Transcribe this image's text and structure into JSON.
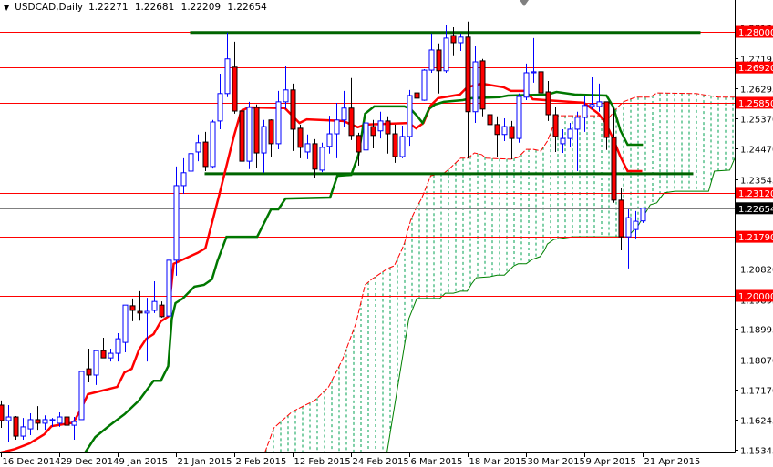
{
  "header": {
    "symbol": "USDCAD,Daily",
    "open": "1.22271",
    "high": "1.22681",
    "low": "1.22209",
    "close": "1.22654"
  },
  "colors": {
    "bull": "#0000ff",
    "bear_fill": "#ff0000",
    "bear_outline": "#000000",
    "tenkan": "#ff0000",
    "kijun": "#007700",
    "senkou_a": "#ff0000",
    "senkou_b": "#008000",
    "cloud": "#00a050",
    "level_line": "#ff0000",
    "trend_line": "#006400",
    "current_price": "#808080"
  },
  "chart_data": {
    "type": "candlestick",
    "title": "USDCAD,Daily",
    "ylim": [
      1.15255,
      1.28966
    ],
    "xlim_bars": [
      0,
      100.7
    ],
    "grid": false,
    "ohlc": [
      [
        1.1669,
        1.1683,
        1.16,
        1.1622
      ],
      [
        1.1622,
        1.1669,
        1.1558,
        1.1633
      ],
      [
        1.1633,
        1.1636,
        1.1564,
        1.1575
      ],
      [
        1.1575,
        1.163,
        1.1564,
        1.1603
      ],
      [
        1.1597,
        1.1644,
        1.1578,
        1.1625
      ],
      [
        1.1625,
        1.1666,
        1.1594,
        1.1614
      ],
      [
        1.1614,
        1.1638,
        1.1594,
        1.1625
      ],
      [
        1.1622,
        1.163,
        1.1603,
        1.1625
      ],
      [
        1.1614,
        1.1647,
        1.1603,
        1.1633
      ],
      [
        1.1633,
        1.1649,
        1.1592,
        1.1608
      ],
      [
        1.1608,
        1.1633,
        1.1564,
        1.1619
      ],
      [
        1.1625,
        1.1771,
        1.1625,
        1.1771
      ],
      [
        1.1779,
        1.184,
        1.1738,
        1.176
      ],
      [
        1.176,
        1.1837,
        1.173,
        1.1834
      ],
      [
        1.1834,
        1.1873,
        1.1812,
        1.1812
      ],
      [
        1.1812,
        1.184,
        1.1801,
        1.1826
      ],
      [
        1.1826,
        1.1887,
        1.1801,
        1.187
      ],
      [
        1.1859,
        1.1972,
        1.1829,
        1.1972
      ],
      [
        1.197,
        1.1992,
        1.1923,
        1.1956
      ],
      [
        1.1953,
        1.2014,
        1.1925,
        1.1948
      ],
      [
        1.1948,
        1.1994,
        1.1801,
        1.1953
      ],
      [
        1.1956,
        1.2044,
        1.1948,
        1.1983
      ],
      [
        1.1972,
        1.1983,
        1.1934,
        1.1937
      ],
      [
        1.1939,
        1.2108,
        1.1939,
        1.2108
      ],
      [
        1.2108,
        1.2392,
        1.2061,
        1.2334
      ],
      [
        1.2334,
        1.2417,
        1.2309,
        1.2373
      ],
      [
        1.2378,
        1.2455,
        1.2353,
        1.2431
      ],
      [
        1.2436,
        1.2489,
        1.2408,
        1.2464
      ],
      [
        1.2466,
        1.2497,
        1.2378,
        1.2392
      ],
      [
        1.2392,
        1.2533,
        1.2386,
        1.2527
      ],
      [
        1.253,
        1.2673,
        1.2505,
        1.2613
      ],
      [
        1.2613,
        1.2798,
        1.2602,
        1.2718
      ],
      [
        1.2693,
        1.277,
        1.2552,
        1.256
      ],
      [
        1.256,
        1.264,
        1.2345,
        1.2408
      ],
      [
        1.2408,
        1.2588,
        1.2384,
        1.2571
      ],
      [
        1.2571,
        1.258,
        1.2389,
        1.2433
      ],
      [
        1.2433,
        1.2533,
        1.2373,
        1.2513
      ],
      [
        1.2533,
        1.2535,
        1.2422,
        1.2461
      ],
      [
        1.2461,
        1.2621,
        1.2444,
        1.2588
      ],
      [
        1.2588,
        1.2696,
        1.2566,
        1.2624
      ],
      [
        1.2624,
        1.2643,
        1.2439,
        1.2505
      ],
      [
        1.2508,
        1.2519,
        1.2417,
        1.245
      ],
      [
        1.2436,
        1.2489,
        1.2414,
        1.2461
      ],
      [
        1.2461,
        1.2475,
        1.2356,
        1.2384
      ],
      [
        1.2381,
        1.2464,
        1.2375,
        1.245
      ],
      [
        1.2453,
        1.2546,
        1.2431,
        1.2491
      ],
      [
        1.2491,
        1.2585,
        1.2417,
        1.2533
      ],
      [
        1.2533,
        1.2621,
        1.2511,
        1.2569
      ],
      [
        1.2569,
        1.266,
        1.2472,
        1.2486
      ],
      [
        1.2486,
        1.2494,
        1.2395,
        1.2436
      ],
      [
        1.2442,
        1.2533,
        1.2386,
        1.2524
      ],
      [
        1.2513,
        1.2533,
        1.2447,
        1.2486
      ],
      [
        1.25,
        1.2558,
        1.2477,
        1.253
      ],
      [
        1.253,
        1.2544,
        1.2431,
        1.2491
      ],
      [
        1.2491,
        1.2519,
        1.2403,
        1.2422
      ],
      [
        1.2422,
        1.2516,
        1.2417,
        1.2483
      ],
      [
        1.2483,
        1.2624,
        1.2455,
        1.2607
      ],
      [
        1.2615,
        1.2624,
        1.2569,
        1.2599
      ],
      [
        1.2593,
        1.2687,
        1.2591,
        1.2684
      ],
      [
        1.2684,
        1.2795,
        1.2676,
        1.2745
      ],
      [
        1.2745,
        1.2765,
        1.2613,
        1.2682
      ],
      [
        1.2682,
        1.282,
        1.2676,
        1.2781
      ],
      [
        1.2789,
        1.2814,
        1.2729,
        1.2767
      ],
      [
        1.2767,
        1.2795,
        1.2742,
        1.2784
      ],
      [
        1.2784,
        1.2831,
        1.2417,
        1.2558
      ],
      [
        1.2558,
        1.2756,
        1.2524,
        1.2709
      ],
      [
        1.2712,
        1.2718,
        1.2544,
        1.2566
      ],
      [
        1.2549,
        1.2613,
        1.2491,
        1.2519
      ],
      [
        1.2519,
        1.2544,
        1.2422,
        1.2489
      ],
      [
        1.2489,
        1.2538,
        1.2469,
        1.2513
      ],
      [
        1.2513,
        1.253,
        1.2414,
        1.2477
      ],
      [
        1.2477,
        1.2613,
        1.2464,
        1.2604
      ],
      [
        1.2602,
        1.2704,
        1.2593,
        1.2676
      ],
      [
        1.2676,
        1.2781,
        1.2646,
        1.2679
      ],
      [
        1.2679,
        1.2707,
        1.2574,
        1.2615
      ],
      [
        1.2618,
        1.2651,
        1.253,
        1.2549
      ],
      [
        1.2549,
        1.2571,
        1.2436,
        1.2483
      ],
      [
        1.2461,
        1.2505,
        1.2433,
        1.2477
      ],
      [
        1.2477,
        1.2524,
        1.245,
        1.2505
      ],
      [
        1.2505,
        1.2558,
        1.2378,
        1.2541
      ],
      [
        1.2541,
        1.2607,
        1.2497,
        1.2577
      ],
      [
        1.2574,
        1.2662,
        1.2566,
        1.258
      ],
      [
        1.2574,
        1.2643,
        1.2558,
        1.2588
      ],
      [
        1.2588,
        1.2588,
        1.2442,
        1.248
      ],
      [
        1.248,
        1.2569,
        1.2282,
        1.229
      ],
      [
        1.229,
        1.2326,
        1.2138,
        1.2179
      ],
      [
        1.2179,
        1.2262,
        1.2083,
        1.2237
      ],
      [
        1.2201,
        1.2257,
        1.2174,
        1.2226
      ],
      [
        1.22271,
        1.22681,
        1.22209,
        1.22654
      ]
    ],
    "tenkan": [
      [
        0,
        1.1525
      ],
      [
        2,
        1.1536
      ],
      [
        4,
        1.1553
      ],
      [
        6,
        1.158
      ],
      [
        7,
        1.1605
      ],
      [
        10,
        1.1616
      ],
      [
        11,
        1.1655
      ],
      [
        12,
        1.1702
      ],
      [
        16,
        1.1724
      ],
      [
        17,
        1.1768
      ],
      [
        18,
        1.1779
      ],
      [
        19,
        1.1837
      ],
      [
        20,
        1.187
      ],
      [
        21,
        1.1884
      ],
      [
        22,
        1.1923
      ],
      [
        23,
        1.1937
      ],
      [
        23.75,
        1.2097
      ],
      [
        27,
        1.213
      ],
      [
        28.1,
        1.2144
      ],
      [
        30,
        1.2306
      ],
      [
        32,
        1.2483
      ],
      [
        33,
        1.256
      ],
      [
        34,
        1.2571
      ],
      [
        39,
        1.2569
      ],
      [
        41,
        1.2524
      ],
      [
        42,
        1.2535
      ],
      [
        47,
        1.253
      ],
      [
        49,
        1.2511
      ],
      [
        50,
        1.2519
      ],
      [
        56,
        1.2524
      ],
      [
        57,
        1.2508
      ],
      [
        58,
        1.2524
      ],
      [
        59,
        1.2577
      ],
      [
        60,
        1.2599
      ],
      [
        63,
        1.261
      ],
      [
        64,
        1.2632
      ],
      [
        66,
        1.2643
      ],
      [
        69,
        1.2632
      ],
      [
        70,
        1.2621
      ],
      [
        72,
        1.2621
      ],
      [
        73,
        1.2596
      ],
      [
        80,
        1.2585
      ],
      [
        82,
        1.2552
      ],
      [
        83,
        1.2524
      ],
      [
        84,
        1.2477
      ],
      [
        85,
        1.2422
      ],
      [
        86,
        1.2378
      ],
      [
        88,
        1.2378
      ]
    ],
    "kijun": [
      [
        11.6,
        1.1525
      ],
      [
        13,
        1.1572
      ],
      [
        15,
        1.1608
      ],
      [
        17,
        1.1641
      ],
      [
        19,
        1.1683
      ],
      [
        21,
        1.1743
      ],
      [
        22,
        1.1743
      ],
      [
        23,
        1.1787
      ],
      [
        23.5,
        1.1931
      ],
      [
        24,
        1.1978
      ],
      [
        25,
        1.1992
      ],
      [
        26.6,
        1.2028
      ],
      [
        27.9,
        1.2033
      ],
      [
        29,
        1.205
      ],
      [
        29.75,
        1.2105
      ],
      [
        31,
        1.2179
      ],
      [
        35.2,
        1.2179
      ],
      [
        37.1,
        1.2262
      ],
      [
        38.1,
        1.2262
      ],
      [
        39.1,
        1.2295
      ],
      [
        45.2,
        1.2298
      ],
      [
        46.2,
        1.2364
      ],
      [
        48.1,
        1.2367
      ],
      [
        49.1,
        1.2428
      ],
      [
        50,
        1.2552
      ],
      [
        51.25,
        1.2574
      ],
      [
        55.4,
        1.2574
      ],
      [
        56.25,
        1.2566
      ],
      [
        57.1,
        1.2546
      ],
      [
        57.9,
        1.2524
      ],
      [
        58.75,
        1.2566
      ],
      [
        59.6,
        1.258
      ],
      [
        60.8,
        1.2588
      ],
      [
        63.4,
        1.2593
      ],
      [
        64.6,
        1.2599
      ],
      [
        68.4,
        1.2602
      ],
      [
        69.6,
        1.2607
      ],
      [
        75,
        1.261
      ],
      [
        76.25,
        1.2618
      ],
      [
        78.75,
        1.261
      ],
      [
        83.1,
        1.2607
      ],
      [
        84,
        1.2574
      ],
      [
        85,
        1.2502
      ],
      [
        86,
        1.2458
      ],
      [
        88.1,
        1.2458
      ]
    ],
    "senkou_a": [
      [
        36.25,
        1.1525
      ],
      [
        37.5,
        1.16
      ],
      [
        40,
        1.1649
      ],
      [
        43.1,
        1.1683
      ],
      [
        45,
        1.1724
      ],
      [
        46.9,
        1.1807
      ],
      [
        48.75,
        1.1917
      ],
      [
        50,
        1.2033
      ],
      [
        50.9,
        1.205
      ],
      [
        53.1,
        1.2083
      ],
      [
        54,
        1.2091
      ],
      [
        55,
        1.2138
      ],
      [
        55.4,
        1.216
      ],
      [
        56.25,
        1.2229
      ],
      [
        57.1,
        1.227
      ],
      [
        57.75,
        1.2295
      ],
      [
        59,
        1.2364
      ],
      [
        60.9,
        1.2373
      ],
      [
        61.6,
        1.2386
      ],
      [
        63.1,
        1.2417
      ],
      [
        64.1,
        1.2417
      ],
      [
        65,
        1.2433
      ],
      [
        66,
        1.2428
      ],
      [
        66.6,
        1.2417
      ],
      [
        70,
        1.2414
      ],
      [
        71,
        1.242
      ],
      [
        72.1,
        1.2444
      ],
      [
        73.1,
        1.2444
      ],
      [
        74.1,
        1.2439
      ],
      [
        75,
        1.2469
      ],
      [
        75.5,
        1.2497
      ],
      [
        76.25,
        1.2546
      ],
      [
        82.1,
        1.2546
      ],
      [
        83.1,
        1.253
      ],
      [
        84.6,
        1.2571
      ],
      [
        85.4,
        1.2588
      ],
      [
        87.1,
        1.2602
      ],
      [
        89.1,
        1.2602
      ],
      [
        90,
        1.2615
      ],
      [
        95.4,
        1.2613
      ],
      [
        98.5,
        1.2602
      ],
      [
        100.75,
        1.2602
      ]
    ],
    "senkou_b": [
      [
        53,
        1.1525
      ],
      [
        56,
        1.1931
      ],
      [
        57.1,
        1.1992
      ],
      [
        60.25,
        1.1992
      ],
      [
        61,
        1.2008
      ],
      [
        62.1,
        1.2008
      ],
      [
        63.1,
        1.2014
      ],
      [
        64,
        1.2014
      ],
      [
        64.6,
        1.2036
      ],
      [
        65.25,
        1.2055
      ],
      [
        67.1,
        1.2058
      ],
      [
        68.1,
        1.2063
      ],
      [
        69.1,
        1.2063
      ],
      [
        70.4,
        1.2091
      ],
      [
        71,
        1.2097
      ],
      [
        72.1,
        1.2097
      ],
      [
        72.9,
        1.211
      ],
      [
        74,
        1.2119
      ],
      [
        74.6,
        1.2138
      ],
      [
        75,
        1.2157
      ],
      [
        75.9,
        1.2171
      ],
      [
        78.4,
        1.2179
      ],
      [
        86,
        1.2179
      ],
      [
        87.5,
        1.2215
      ],
      [
        89.1,
        1.2276
      ],
      [
        90,
        1.2282
      ],
      [
        91,
        1.2312
      ],
      [
        92.5,
        1.2317
      ],
      [
        97.1,
        1.2317
      ],
      [
        97.9,
        1.2378
      ],
      [
        100,
        1.2381
      ],
      [
        101,
        1.2433
      ]
    ],
    "level_lines": [
      {
        "price": 1.28,
        "label": "1.28000"
      },
      {
        "price": 1.2692,
        "label": "1.26920"
      },
      {
        "price": 1.2585,
        "label": "1.25850"
      },
      {
        "price": 1.2312,
        "label": "1.23120"
      },
      {
        "price": 1.2179,
        "label": "1.21790"
      },
      {
        "price": 1.2,
        "label": "1.20000"
      }
    ],
    "trend_lines": [
      {
        "from_bar": 26,
        "to_bar": 96,
        "price": 1.2798
      },
      {
        "from_bar": 28,
        "to_bar": 95,
        "price": 1.237
      }
    ],
    "current_price": {
      "price": 1.22654,
      "label": "1.22654"
    },
    "y_ticks": [
      {
        "value": 1.2813,
        "label": "1.28130"
      },
      {
        "value": 1.27195,
        "label": "1.27195"
      },
      {
        "value": 1.26295,
        "label": "1.26295"
      },
      {
        "value": 1.2537,
        "label": "1.25370"
      },
      {
        "value": 1.2447,
        "label": "1.24470"
      },
      {
        "value": 1.23545,
        "label": "1.23545"
      },
      {
        "value": 1.2082,
        "label": "1.20820"
      },
      {
        "value": 1.19895,
        "label": "1.19895"
      },
      {
        "value": 1.18995,
        "label": "1.18995"
      },
      {
        "value": 1.1807,
        "label": "1.18070"
      },
      {
        "value": 1.1717,
        "label": "1.17170"
      },
      {
        "value": 1.16245,
        "label": "1.16245"
      },
      {
        "value": 1.15345,
        "label": "1.15345"
      }
    ],
    "x_ticks": [
      {
        "bar": 0,
        "label": "16 Dec 2014"
      },
      {
        "bar": 8,
        "label": "29 Dec 2014"
      },
      {
        "bar": 16,
        "label": "9 Jan 2015"
      },
      {
        "bar": 24,
        "label": "21 Jan 2015"
      },
      {
        "bar": 32,
        "label": "2 Feb 2015"
      },
      {
        "bar": 40,
        "label": "12 Feb 2015"
      },
      {
        "bar": 48,
        "label": "24 Feb 2015"
      },
      {
        "bar": 56,
        "label": "6 Mar 2015"
      },
      {
        "bar": 64,
        "label": "18 Mar 2015"
      },
      {
        "bar": 72,
        "label": "30 Mar 2015"
      },
      {
        "bar": 80,
        "label": "9 Apr 2015"
      },
      {
        "bar": 88,
        "label": "21 Apr 2015"
      }
    ]
  }
}
